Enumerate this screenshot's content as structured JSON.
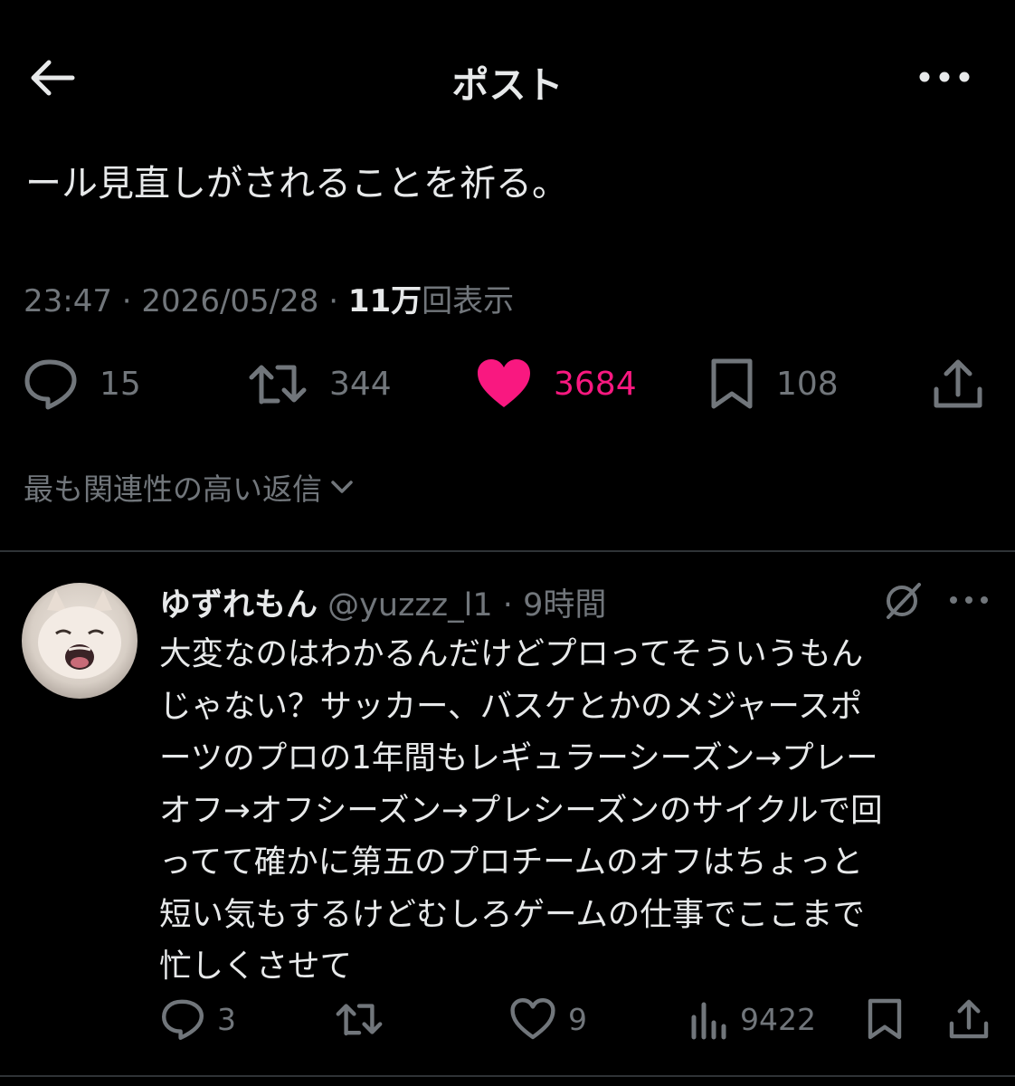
{
  "header": {
    "title": "ポスト"
  },
  "post": {
    "text": "ール見直しがされることを祈る。",
    "time": "23:47",
    "date": "2026/05/28",
    "views_count": "11万",
    "views_label": "回表示",
    "sep": " · ",
    "stats": {
      "replies": "15",
      "reposts": "344",
      "likes": "3684",
      "bookmarks": "108"
    },
    "like_color": "#f91880"
  },
  "sort": {
    "label": "最も関連性の高い返信"
  },
  "reply": {
    "name": "ゆずれもん",
    "handle": "@yuzzz_l1",
    "time": "9時間",
    "lines": [
      "大変なのはわかるんだけどプロってそういうもん",
      "じゃない？サッカー、バスケとかのメジャースポ",
      "ーツのプロの1年間もレギュラーシーズン→プレー",
      "オフ→オフシーズン→プレシーズンのサイクルで回",
      "ってて確かに第五のプロチームのオフはちょっと",
      "短い気もするけどむしろゲームの仕事でここまで",
      "忙しくさせて"
    ],
    "stats": {
      "replies": "3",
      "reposts": "",
      "likes": "9",
      "views": "9422"
    }
  },
  "icons": {
    "back": "arrow-left-icon",
    "more": "more-horizontal-icon",
    "reply": "speech-bubble-icon",
    "repost": "repost-icon",
    "like": "heart-icon",
    "bookmark": "bookmark-icon",
    "share": "share-icon",
    "views": "bar-chart-icon",
    "grok": "grok-icon",
    "chevron": "chevron-down-icon"
  }
}
